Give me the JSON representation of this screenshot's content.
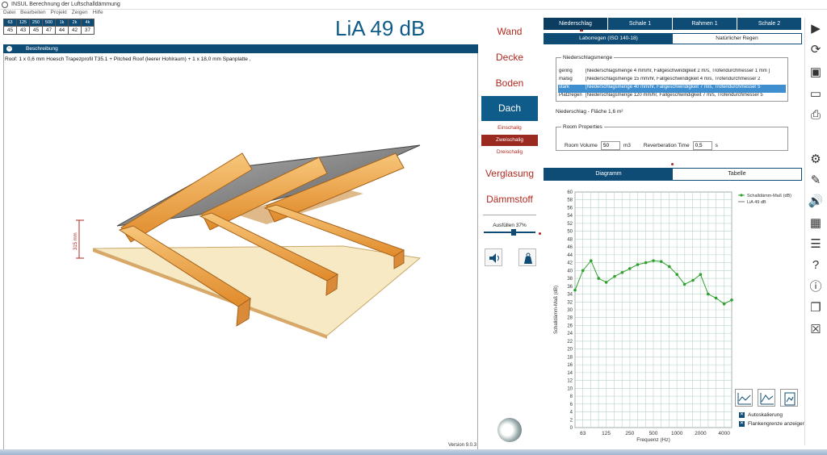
{
  "window": {
    "title": "INSUL Berechnung der Luftschalldämmung"
  },
  "menu": [
    "Datei",
    "Bearbeiten",
    "Projekt",
    "Zeigen",
    "Hilfe"
  ],
  "freq_table": {
    "headers": [
      "63",
      "125",
      "250",
      "500",
      "1k",
      "2k",
      "4k"
    ],
    "values": [
      "45",
      "43",
      "45",
      "47",
      "44",
      "42",
      "37"
    ]
  },
  "result": {
    "lia": "LiA 49 dB"
  },
  "left": {
    "section_label": "Beschreibung",
    "description": "Roof: 1 x 0,6 mm Hoesch Trapezprofil T35.1 + Pitched Roof (leerer Hohlraum) + 1 x 18,0 mm Spanplatte ,",
    "dimension_label": "315 mm",
    "version": "Version 9.0.3"
  },
  "nav": {
    "items": [
      "Wand",
      "Decke",
      "Boden",
      "Dach",
      "Verglasung",
      "Dämmstoff"
    ],
    "active": "Dach",
    "sub_items": [
      "Einschalig",
      "Zweischalig",
      "Dreischalig"
    ],
    "sub_selected": "Zweischalig",
    "fill_label": "Ausfüllen 37%",
    "fill_level": 0.6
  },
  "tabs_top": [
    "Niederschlag",
    "Schale 1",
    "Rahmen 1",
    "Schale 2"
  ],
  "tabs_sub": [
    "Laborregen (ISO 140-18)",
    "Natürlicher Regen"
  ],
  "precip": {
    "legend": "Niederschlagsmenge",
    "rows": [
      {
        "key": "gering",
        "desc": "[Niederschlagsmenge 4 mm/hr, Fallgeschwindigkeit 2 m/s, Trofendurchmesser 1  mm ]"
      },
      {
        "key": "mäßig",
        "desc": "[Niederschlagsmenge 15 mm/hr, Fallgeschwindigkeit 4 m/s, Trofendurchmesser 2"
      },
      {
        "key": "stark",
        "desc": "[Niederschlagsmenge 40 mm/hr, Fallgeschwindigkeit 7 m/s, Trofendurchmesser 5"
      },
      {
        "key": "Platzregen",
        "desc": "[Niederschlagsmenge 120 mm/hr, Fallgeschwindigkeit 7 m/s, Trofendurchmesser 5"
      }
    ],
    "selected_index": 2,
    "area_text": "Niederschlag - Fläche 1,6 m²"
  },
  "room": {
    "legend": "Room Properties",
    "volume_label": "Room Volume",
    "volume_value": "50",
    "volume_unit": "m3",
    "rt_label": "Reverberation Time",
    "rt_value": "0,5",
    "rt_unit": "s"
  },
  "tabs_chart": [
    "Diagramm",
    "Tabelle"
  ],
  "chart_data": {
    "type": "line",
    "ylabel": "Schalldämm-Maß (dB)",
    "xlabel": "Frequenz (Hz)",
    "ylim": [
      0,
      60
    ],
    "yticks": [
      0,
      2,
      4,
      6,
      8,
      10,
      12,
      14,
      16,
      18,
      20,
      22,
      24,
      26,
      28,
      30,
      32,
      34,
      36,
      38,
      40,
      42,
      44,
      46,
      48,
      50,
      52,
      54,
      56,
      58,
      60
    ],
    "xtick_labels": [
      "63",
      "125",
      "250",
      "500",
      "1000",
      "2000",
      "4000"
    ],
    "xlim": [
      50,
      5000
    ],
    "grid": true,
    "legend_position": "top-right",
    "legend": [
      "Schalldämm-Maß (dB)",
      "LiA 49 dB"
    ],
    "series": [
      {
        "name": "Schalldämm-Maß (dB)",
        "x": [
          50,
          63,
          80,
          100,
          125,
          160,
          200,
          250,
          315,
          400,
          500,
          630,
          800,
          1000,
          1250,
          1600,
          2000,
          2500,
          3150,
          4000,
          5000
        ],
        "y": [
          35,
          40,
          42.5,
          38,
          37,
          38.5,
          39.5,
          40.5,
          41.5,
          42,
          42.5,
          42.3,
          41,
          39,
          36.5,
          37.5,
          39,
          34,
          33,
          31.5,
          32.5
        ]
      }
    ],
    "color": "#2ea02e"
  },
  "chart_options": {
    "autoscale": "Autoskalierung",
    "flank": "Flankengrenze anzeigen"
  }
}
